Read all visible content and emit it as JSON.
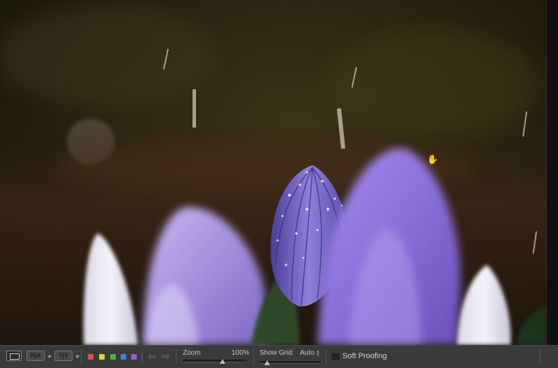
{
  "toolbar": {
    "zoom_label": "Zoom",
    "zoom_value": "100%",
    "zoom_level": 0.62,
    "grid_label": "Show Grid:",
    "grid_value": "Auto",
    "grid_slider_level": 0.12,
    "soft_proofing_label": "Soft Proofing",
    "soft_proofing_checked": false,
    "color_labels": [
      "#d9534a",
      "#e2d13a",
      "#4fb04a",
      "#4a7fd6",
      "#9a5bd1"
    ],
    "icons": {
      "loupe": "loupe-view-icon",
      "compare": "compare-view-icon",
      "survey": "survey-view-icon",
      "prev": "arrow-left-icon",
      "next": "arrow-right-icon"
    }
  },
  "photo": {
    "subject": "crocus-photo",
    "cursor": "hand-cursor-icon"
  }
}
